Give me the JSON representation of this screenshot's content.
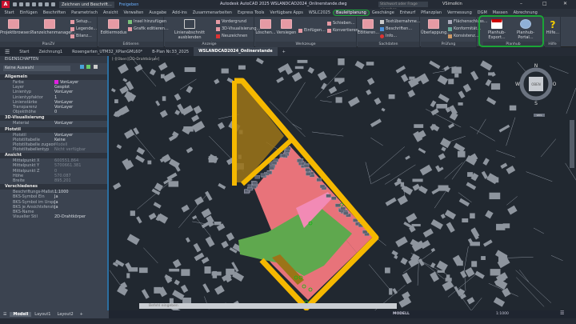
{
  "app": {
    "logo": "A",
    "workspace": "Zeichnen und Beschrift...",
    "share": "Freigeben",
    "title": "Autodesk AutoCAD 2025   WSLANDCAD2024_Onlinerstande.dwg",
    "search_placeholder": "Stichwort oder Frage eingeben",
    "user": "VSimolkin"
  },
  "ribbon_tabs": [
    "Start",
    "Einfügen",
    "Beschriften",
    "Parametrisch",
    "Ansicht",
    "Verwalten",
    "Ausgabe",
    "Add-ins",
    "Zusammenarbeiten",
    "Express Tools",
    "Verfügbare Apps",
    "WSLC2025",
    "Bauleitplanung",
    "Geschänge",
    "Entwurf",
    "Pflanzplan",
    "Vermessung",
    "DGM",
    "Massen",
    "Abrechnung"
  ],
  "active_ribbon_tab": "Bauleitplanung",
  "panels": {
    "planzv": {
      "title": "PlanZV",
      "items": [
        "Projektbrowser...",
        "Planzeichenmanager...",
        "Setup...",
        "Legende...",
        "Bilanz..."
      ]
    },
    "editieren": {
      "title": "Editieren",
      "items": [
        "Editiermodus",
        "Insel hinzufügen",
        "Grafik editieren..."
      ]
    },
    "anzeige": {
      "title": "Anzeige",
      "items": [
        "Linienabschnitt ausblenden",
        "Vordergrund",
        "3D-Visualisierung...",
        "Neuzeichnen"
      ]
    },
    "werkzeuge": {
      "title": "Werkzeuge",
      "items": [
        "Löschen...",
        "Versiegen",
        "Einfügen...",
        "Schieben...",
        "Konvertieren..."
      ]
    },
    "sachdaten": {
      "title": "Sachdaten",
      "items": [
        "Editieren...",
        "Textübernahme...",
        "Beschriften...",
        "Info..."
      ]
    },
    "pruefung": {
      "title": "Prüfung",
      "items": [
        "Überlappung...",
        "Flächenschluss...",
        "Konformität...",
        "Konsistenz..."
      ]
    },
    "planhub": {
      "title": "Planhub",
      "items": [
        "Planhub-Export...",
        "Planhub-Portal..."
      ]
    },
    "hilfe": {
      "title": "Hilfe",
      "items": [
        "Hilfe..."
      ]
    }
  },
  "file_tabs": [
    "Start",
    "Zeichnung1",
    "Rosengarten_UTM32_XPlanGML60*",
    "B-Plan Nr.33_2025",
    "WSLANDCAD2024_Onlinerstande"
  ],
  "active_file_tab": "WSLANDCAD2024_Onlinerstande",
  "properties": {
    "header": "EIGENSCHAFTEN",
    "selection": "Keine Auswahl",
    "sections": [
      {
        "title": "Allgemein",
        "rows": [
          [
            "Farbe",
            "VonLayer"
          ],
          [
            "Layer",
            "Gesplot"
          ],
          [
            "Linientyp",
            "VonLayer"
          ],
          [
            "Linientypfaktor",
            "1"
          ],
          [
            "Linienstärke",
            "VonLayer"
          ],
          [
            "Transparenz",
            "VonLayer"
          ],
          [
            "Objekthöhe",
            "0"
          ]
        ]
      },
      {
        "title": "3D-Visualisierung",
        "rows": [
          [
            "Material",
            "VonLayer"
          ]
        ]
      },
      {
        "title": "Plotstil",
        "rows": [
          [
            "Plotstil",
            "VonLayer"
          ],
          [
            "Plotstiltabelle",
            "Keine"
          ],
          [
            "Plotstiltabelle zugeordnet...",
            "Modell"
          ],
          [
            "Plotstiltabellentyp",
            "Nicht verfügbar"
          ]
        ]
      },
      {
        "title": "Ansicht",
        "rows": [
          [
            "Mittelpunkt X",
            "600551.864"
          ],
          [
            "Mittelpunkt Y",
            "5700661.381"
          ],
          [
            "Mittelpunkt Z",
            "0"
          ],
          [
            "Höhe",
            "570.087"
          ],
          [
            "Breite",
            "895.201"
          ]
        ]
      },
      {
        "title": "Verschiedenes",
        "rows": [
          [
            "Beschriftungs-Maßstab",
            "1:1000"
          ],
          [
            "BKS-Symbol Ein",
            "Ja"
          ],
          [
            "BKS-Symbol im Ursprung",
            "Ja"
          ],
          [
            "BKS je Ansichtsfenster",
            "Ja"
          ],
          [
            "BKS-Name",
            ""
          ],
          [
            "Visueller Stil",
            "2D-Drahtkörper"
          ]
        ]
      }
    ]
  },
  "layout_tabs": [
    "Modell",
    "Layout1",
    "Layout2"
  ],
  "viewport_label": "[-][Oben][2D-Drahtkörper]",
  "viewcube": {
    "n": "N",
    "s": "S",
    "w": "W",
    "e": "O",
    "face": "OBEN",
    "wcs": "WKS"
  },
  "command_placeholder": "Befehl eingeben",
  "status": {
    "mode": "MODELL",
    "scale": "1:1000"
  },
  "colors": {
    "highlight": "#1aa536",
    "boundary": "#f5b800",
    "residential": "#e8737a",
    "green": "#5fa84e",
    "brown": "#9c7418",
    "pink": "#f28ab5",
    "accent_red": "#c8102e"
  }
}
